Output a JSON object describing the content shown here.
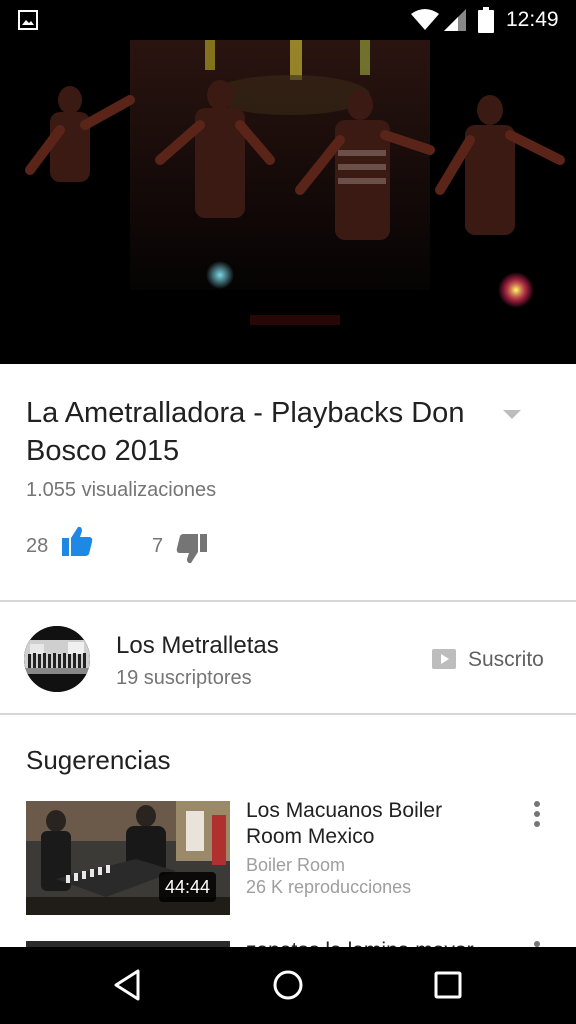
{
  "status_bar": {
    "time": "12:49",
    "icons": [
      "image-icon",
      "wifi-icon",
      "signal-icon",
      "battery-icon"
    ]
  },
  "video": {
    "title": "La Ametralladora - Playbacks Don Bosco 2015",
    "views": "1.055 visualizaciones",
    "likes": "28",
    "dislikes": "7",
    "like_color": "#1e88e5"
  },
  "channel": {
    "name": "Los Metralletas",
    "subscribers": "19 suscriptores",
    "subscribe_label": "Suscrito"
  },
  "suggestions": {
    "heading": "Sugerencias",
    "items": [
      {
        "title": "Los Macuanos Boiler Room Mexico",
        "channel": "Boiler Room",
        "views": "26 K reproducciones",
        "duration": "44:44"
      },
      {
        "title": "zapatos la lamina mayor"
      }
    ]
  },
  "nav_bar": {
    "icons": [
      "back-icon",
      "home-icon",
      "recents-icon"
    ]
  }
}
